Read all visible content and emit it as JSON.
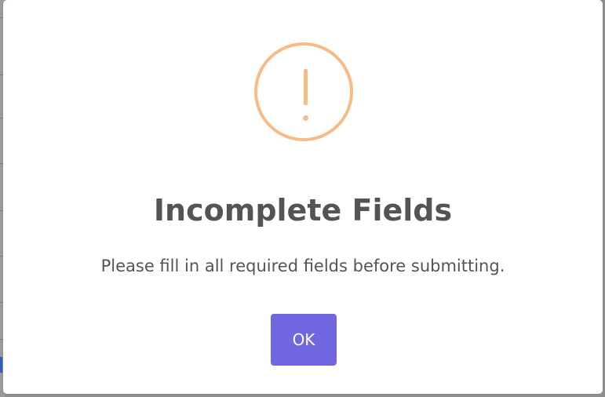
{
  "dialog": {
    "icon": "warning-icon",
    "icon_glyph": "!",
    "title": "Incomplete Fields",
    "message": "Please fill in all required fields before submitting.",
    "confirm_label": "OK"
  },
  "colors": {
    "warning": "#f8bb86",
    "confirm_button": "#7066e0",
    "text": "#545454",
    "dialog_background": "#ffffff"
  }
}
